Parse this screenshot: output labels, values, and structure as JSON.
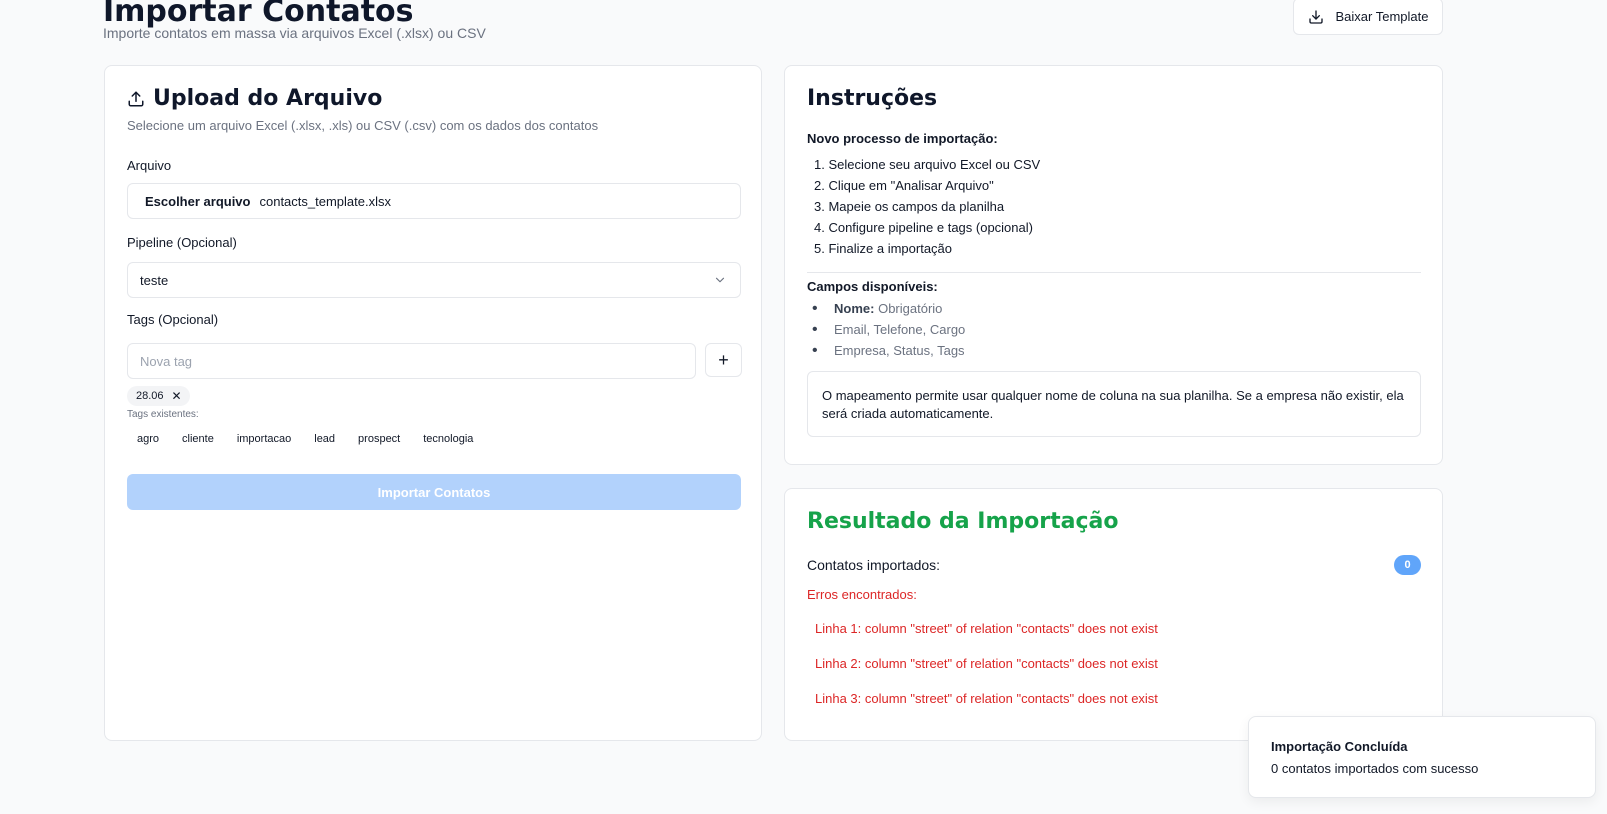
{
  "header": {
    "title": "Importar Contatos",
    "subtitle": "Importe contatos em massa via arquivos Excel (.xlsx) ou CSV",
    "template_button": "Baixar Template"
  },
  "upload": {
    "title": "Upload do Arquivo",
    "description": "Selecione um arquivo Excel (.xlsx, .xls) ou CSV (.csv) com os dados dos contatos",
    "file_label": "Arquivo",
    "choose_label": "Escolher arquivo",
    "file_name": "contacts_template.xlsx",
    "pipeline_label": "Pipeline (Opcional)",
    "pipeline_value": "teste",
    "tags_label": "Tags (Opcional)",
    "tag_placeholder": "Nova tag",
    "add_tag": "+",
    "selected_tag": "28.06",
    "existing_label": "Tags existentes:",
    "existing_tags": [
      "agro",
      "cliente",
      "importacao",
      "lead",
      "prospect",
      "tecnologia"
    ],
    "import_button": "Importar Contatos"
  },
  "instructions": {
    "title": "Instruções",
    "process_heading": "Novo processo de importação:",
    "steps": [
      "1. Selecione seu arquivo Excel ou CSV",
      "2. Clique em \"Analisar Arquivo\"",
      "3. Mapeie os campos da planilha",
      "4. Configure pipeline e tags (opcional)",
      "5. Finalize a importação"
    ],
    "fields_heading": "Campos disponíveis:",
    "field_required_name": "Nome:",
    "field_required_text": "Obrigatório",
    "field_2": "Email, Telefone, Cargo",
    "field_3": "Empresa, Status, Tags",
    "note": "O mapeamento permite usar qualquer nome de coluna na sua planilha. Se a empresa não existir, ela será criada automaticamente."
  },
  "result": {
    "title": "Resultado da Importação",
    "imported_label": "Contatos importados:",
    "imported_count": "0",
    "errors_label": "Erros encontrados:",
    "errors": [
      "Linha 1: column \"street\" of relation \"contacts\" does not exist",
      "Linha 2: column \"street\" of relation \"contacts\" does not exist",
      "Linha 3: column \"street\" of relation \"contacts\" does not exist"
    ]
  },
  "toast": {
    "title": "Importação Concluída",
    "message": "0 contatos importados com sucesso"
  },
  "colors": {
    "success": "#16a34a",
    "error": "#dc2626",
    "primary_disabled": "#b2d2fc",
    "badge": "#60a5fa"
  }
}
